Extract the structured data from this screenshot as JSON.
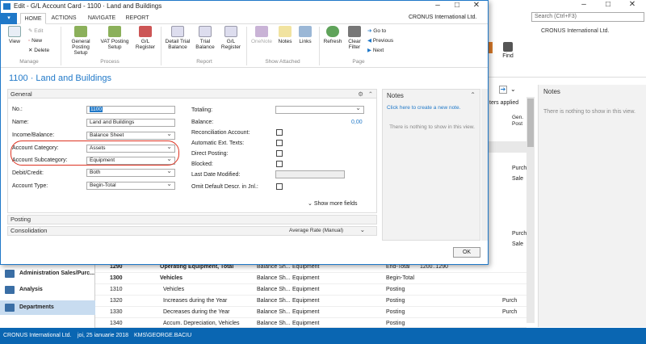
{
  "background": {
    "search_placeholder": "Search (Ctrl+F3)",
    "company": "CRONUS International Ltd.",
    "find_label": "Find",
    "filters_text": "ters applied",
    "notes_title": "Notes",
    "notes_empty": "There is nothing to show in this view.",
    "col_header": "Gen. Post",
    "side_values": [
      "Purch",
      "Sale",
      "Purch",
      "Sale"
    ],
    "nav_items": [
      {
        "label": "Administration Sales/Purc...",
        "selected": false
      },
      {
        "label": "Analysis",
        "selected": false
      },
      {
        "label": "Departments",
        "selected": true
      }
    ],
    "rows": [
      {
        "no": "1290",
        "name": "Operating Equipment, Total",
        "inc": "Balance Sh...",
        "cat": "Equipment",
        "type": "End-Total",
        "tot": "1200..1290",
        "bold": true,
        "gen": ""
      },
      {
        "no": "1300",
        "name": "Vehicles",
        "inc": "Balance Sh...",
        "cat": "Equipment",
        "type": "Begin-Total",
        "tot": "",
        "bold": true,
        "gen": ""
      },
      {
        "no": "1310",
        "name": "Vehicles",
        "inc": "Balance Sh...",
        "cat": "Equipment",
        "type": "Posting",
        "tot": "",
        "bold": false,
        "gen": ""
      },
      {
        "no": "1320",
        "name": "Increases during the Year",
        "inc": "Balance Sh...",
        "cat": "Equipment",
        "type": "Posting",
        "tot": "",
        "bold": false,
        "gen": "Purch"
      },
      {
        "no": "1330",
        "name": "Decreases during the Year",
        "inc": "Balance Sh...",
        "cat": "Equipment",
        "type": "Posting",
        "tot": "",
        "bold": false,
        "gen": "Purch"
      },
      {
        "no": "1340",
        "name": "Accum. Depreciation, Vehicles",
        "inc": "Balance Sh...",
        "cat": "Equipment",
        "type": "Posting",
        "tot": "",
        "bold": false,
        "gen": ""
      }
    ],
    "status": {
      "company": "CRONUS International Ltd.",
      "date": "joi, 25 ianuarie 2018",
      "user": "KMS\\GEORGE.BACIU"
    }
  },
  "dialog": {
    "title": "Edit - G/L Account Card - 1100 · Land and Buildings",
    "tabs": [
      "HOME",
      "ACTIONS",
      "NAVIGATE",
      "REPORT"
    ],
    "company": "CRONUS International Ltd.",
    "ribbon": {
      "manage": {
        "view": "View",
        "edit": "Edit",
        "new": "New",
        "delete": "Delete",
        "group": "Manage"
      },
      "process": {
        "buttons": [
          "General Posting Setup",
          "VAT Posting Setup",
          "G/L Register"
        ],
        "group": "Process"
      },
      "report": {
        "buttons": [
          "Detail Trial Balance",
          "Trial Balance",
          "G/L Register"
        ],
        "group": "Report"
      },
      "attached": {
        "buttons": [
          "OneNote",
          "Notes",
          "Links"
        ],
        "group": "Show Attached"
      },
      "page": {
        "buttons": [
          "Refresh",
          "Clear Filter"
        ],
        "goto": "Go to",
        "previous": "Previous",
        "next": "Next",
        "group": "Page"
      }
    },
    "page_title": "1100 · Land and Buildings",
    "general": {
      "header": "General",
      "no_label": "No.:",
      "no_value": "1100",
      "name_label": "Name:",
      "name_value": "Land and Buildings",
      "income_label": "Income/Balance:",
      "income_value": "Balance Sheet",
      "cat_label": "Account Category:",
      "cat_value": "Assets",
      "subcat_label": "Account Subcategory:",
      "subcat_value": "Equipment",
      "debit_label": "Debit/Credit:",
      "debit_value": "Both",
      "type_label": "Account Type:",
      "type_value": "Begin-Total",
      "totaling_label": "Totaling:",
      "totaling_value": "",
      "balance_label": "Balance:",
      "balance_value": "0,00",
      "recon_label": "Reconciliation Account:",
      "autotext_label": "Automatic Ext. Texts:",
      "direct_label": "Direct Posting:",
      "blocked_label": "Blocked:",
      "lastmod_label": "Last Date Modified:",
      "omit_label": "Omit Default Descr. in Jnl.:",
      "show_more": "Show more fields"
    },
    "posting_header": "Posting",
    "consolidation_header": "Consolidation",
    "consolidation_value": "Average Rate (Manual)",
    "notes": {
      "title": "Notes",
      "link": "Click here to create a new note.",
      "empty": "There is nothing to show in this view."
    },
    "ok": "OK"
  }
}
